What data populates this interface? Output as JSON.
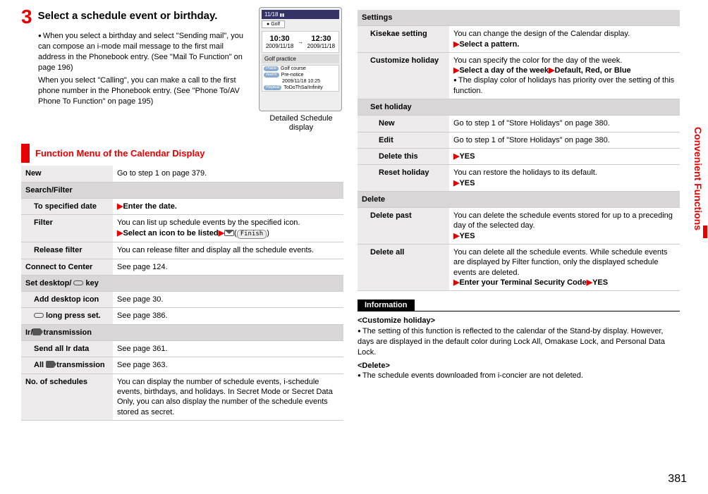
{
  "step": {
    "num": "3",
    "title": "Select a schedule event or birthday.",
    "body1": "When you select a birthday and select \"Sending mail\", you can compose an i-mode mail message to the first mail address in the Phonebook entry. (See \"Mail To Function\" on page 196)",
    "body2": "When you select \"Calling\", you can make a call to the first phone number in the Phonebook entry. (See \"Phone To/AV Phone To Function\" on page 195)"
  },
  "phone": {
    "topbar": "11/18",
    "tab": "Golf",
    "time1_big": "10:30",
    "time1_small": "2009/11/18",
    "arrow": "→",
    "time2_big": "12:30",
    "time2_small": "2009/11/18",
    "subtitle": "Golf practice",
    "row1_label": "Place",
    "row1_text": "Golf course",
    "row2_label": "Alarm",
    "row2_text": "Pre-notice",
    "row2_sub": "2009/11/18 10:25",
    "row3_label": "Repeat",
    "row3_text": "ToDoThSa/Infinity",
    "caption1": "Detailed Schedule",
    "caption2": "display"
  },
  "menu_title": "Function Menu of the Calendar Display",
  "left_table": {
    "new_label": "New",
    "new_desc": "Go to step 1 on page 379.",
    "search_header": "Search/Filter",
    "tospec_label": "To specified date",
    "tospec_desc": "Enter the date.",
    "filter_label": "Filter",
    "filter_desc1": "You can list up schedule events by the specified icon.",
    "filter_desc2": "Select an icon to be listed",
    "finish": "Finish",
    "release_label": "Release filter",
    "release_desc": "You can release filter and display all the schedule events.",
    "connect_label": "Connect to Center",
    "connect_desc": "See page 124.",
    "desktop_header": "Set desktop/         key",
    "add_icon_label": "Add desktop icon",
    "add_icon_desc": "See page 30.",
    "longpress_label": "        long press set.",
    "longpress_desc": "See page 386.",
    "ir_header": "Ir/        transmission",
    "sendall_label": "Send all Ir data",
    "sendall_desc": "See page 361.",
    "alltrans_label": "All        transmission",
    "alltrans_desc": "See page 363.",
    "nosched_label": "No. of schedules",
    "nosched_desc": "You can display the number of schedule events, i-schedule events, birthdays, and holidays. In Secret Mode or Secret Data Only, you can also display the number of the schedule events stored as secret."
  },
  "right_table": {
    "settings_header": "Settings",
    "kisekae_label": "Kisekae setting",
    "kisekae_desc1": "You can change the design of the Calendar display.",
    "kisekae_desc2": "Select a pattern.",
    "custom_label": "Customize holiday",
    "custom_desc1": "You can specify the color for the day of the week.",
    "custom_desc2a": "Select a day of the week",
    "custom_desc2b": "Default, Red, or Blue",
    "custom_desc3": "The display color of holidays has priority over the setting of this function.",
    "sethol_header": "Set holiday",
    "new_label": "New",
    "new_desc": "Go to step 1 of \"Store Holidays\" on page 380.",
    "edit_label": "Edit",
    "edit_desc": "Go to step 1 of \"Store Holidays\" on page 380.",
    "del_label": "Delete this",
    "del_desc": "YES",
    "reset_label": "Reset holiday",
    "reset_desc1": "You can restore the holidays to its default.",
    "reset_desc2": "YES",
    "delete_header": "Delete",
    "delpast_label": "Delete past",
    "delpast_desc1": "You can delete the schedule events stored for up to a preceding day of the selected day.",
    "delpast_desc2": "YES",
    "delall_label": "Delete all",
    "delall_desc1": "You can delete all the schedule events. While schedule events are displayed by Filter function, only the displayed schedule events are deleted.",
    "delall_desc2a": "Enter your Terminal Security Code",
    "delall_desc2b": "YES"
  },
  "info": {
    "tag": "Information",
    "sub1": "<Customize holiday>",
    "p1": "The setting of this function is reflected to the calendar of the Stand-by display. However, days are displayed in the default color during Lock All, Omakase Lock, and Personal Data Lock.",
    "sub2": "<Delete>",
    "p2": "The schedule events downloaded from i-concier are not deleted."
  },
  "side_tab": "Convenient Functions",
  "page_num": "381"
}
